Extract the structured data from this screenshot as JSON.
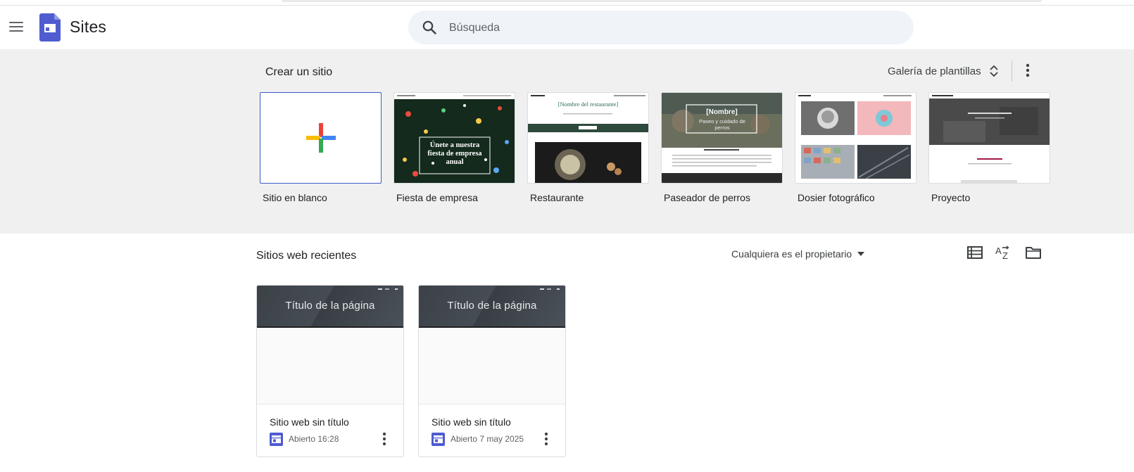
{
  "app": {
    "title": "Sites"
  },
  "search": {
    "placeholder": "Búsqueda"
  },
  "create": {
    "title": "Crear un sitio",
    "gallery_label": "Galería de plantillas",
    "templates": [
      {
        "name": "Sitio en blanco"
      },
      {
        "name": "Fiesta de empresa",
        "thumb_text": "Únete a nuestra fiesta de empresa anual"
      },
      {
        "name": "Restaurante",
        "thumb_text": "[Nombre del restaurante]"
      },
      {
        "name": "Paseador de perros",
        "thumb_text": "[Nombre]",
        "thumb_sub": "Paseo y cuidado de perros"
      },
      {
        "name": "Dosier fotográfico"
      },
      {
        "name": "Proyecto"
      }
    ]
  },
  "recent": {
    "title": "Sitios web recientes",
    "owner_filter": "Cualquiera es el propietario",
    "sites": [
      {
        "banner_title": "Título de la página",
        "name": "Sitio web sin título",
        "opened": "Abierto 16:28"
      },
      {
        "banner_title": "Título de la página",
        "name": "Sitio web sin título",
        "opened": "Abierto 7 may 2025"
      }
    ]
  },
  "icons": {
    "menu": "menu-icon",
    "search": "search-icon",
    "unfold": "unfold-more-icon",
    "more": "more-vert-icon",
    "list_view": "list-view-icon",
    "sort": "sort-az-icon",
    "folder": "folder-icon",
    "site": "sites-file-icon"
  },
  "colors": {
    "accent": "#4e5ccf",
    "section_bg": "#f0f0f0",
    "search_bg": "#f0f3f8"
  }
}
